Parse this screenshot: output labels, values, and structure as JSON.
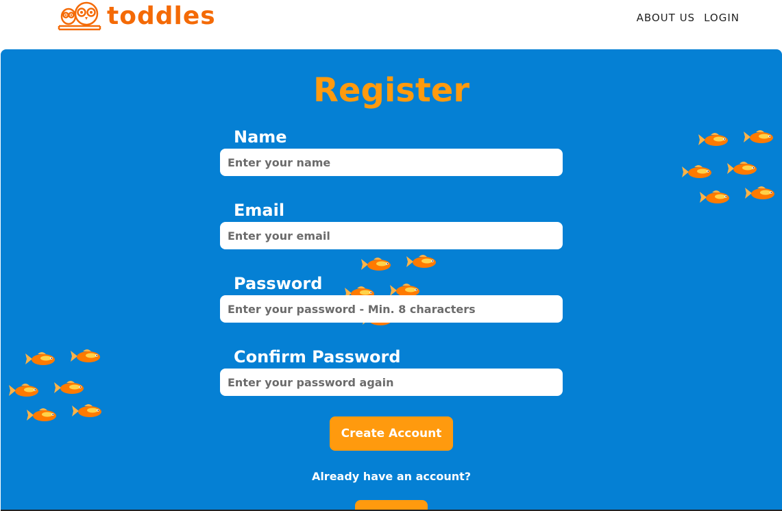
{
  "brand": {
    "name": "toddles",
    "color": "#f46a06"
  },
  "nav": {
    "items": [
      {
        "label": "ABOUT US"
      },
      {
        "label": "LOGIN"
      }
    ]
  },
  "form": {
    "title": "Register",
    "fields": [
      {
        "label": "Name",
        "placeholder": "Enter your name",
        "value": ""
      },
      {
        "label": "Email",
        "placeholder": "Enter your email",
        "value": ""
      },
      {
        "label": "Password",
        "placeholder": "Enter your password - Min. 8 characters",
        "value": ""
      },
      {
        "label": "Confirm Password",
        "placeholder": "Enter your password again",
        "value": ""
      }
    ],
    "submit_label": "Create Account",
    "already_text": "Already have an account?"
  },
  "colors": {
    "panel": "#0580d4",
    "accent": "#ff9a0e",
    "fish": "#ff7a00"
  },
  "icons": {
    "logo": "owl-books-icon",
    "decoration": "goldfish-icon"
  }
}
